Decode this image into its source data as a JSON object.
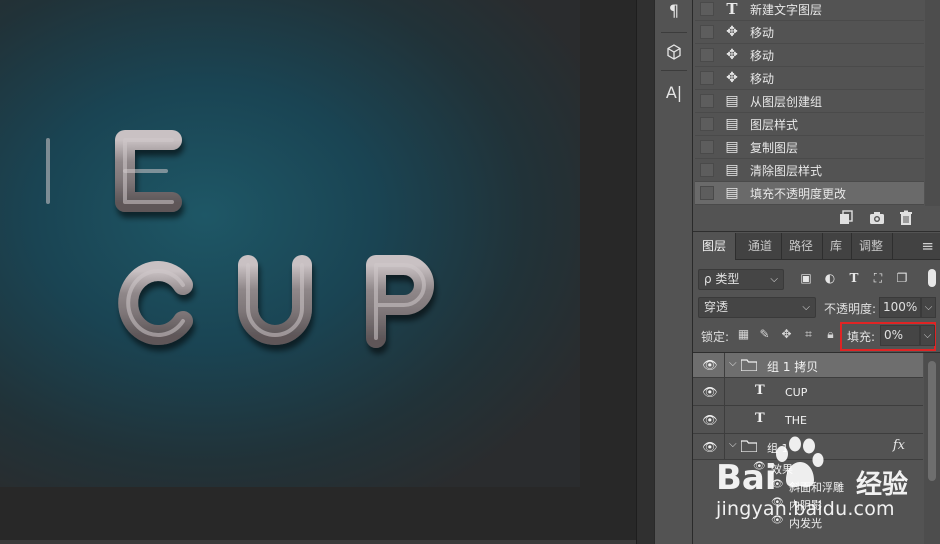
{
  "canvas": {
    "lines": [
      "HE",
      "CUP"
    ],
    "bg_color": "#1e5766",
    "text_color": "#9a9294"
  },
  "tool_strip": {
    "paragraph_icon": "pilcrow-icon",
    "cube_icon": "3d-cube-icon",
    "char_icon": "character-icon",
    "char_glyph": "A|"
  },
  "history": {
    "items": [
      {
        "icon": "T",
        "label": "新建文字图层"
      },
      {
        "icon": "✥",
        "label": "移动"
      },
      {
        "icon": "✥",
        "label": "移动"
      },
      {
        "icon": "✥",
        "label": "移动"
      },
      {
        "icon": "▤",
        "label": "从图层创建组"
      },
      {
        "icon": "▤",
        "label": "图层样式"
      },
      {
        "icon": "▤",
        "label": "复制图层"
      },
      {
        "icon": "▤",
        "label": "清除图层样式"
      },
      {
        "icon": "▤",
        "label": "填充不透明度更改"
      }
    ]
  },
  "layers_panel": {
    "tabs": [
      "图层",
      "通道",
      "路径",
      "库",
      "调整"
    ],
    "filter": {
      "label": "ρ 类型"
    },
    "blend_mode": "穿透",
    "opacity_label": "不透明度:",
    "opacity_value": "100%",
    "lock_label": "锁定:",
    "fill_label": "填充:",
    "fill_value": "0%",
    "highlight_color": "#e02424",
    "layers": [
      {
        "type": "group",
        "name": "组 1 拷贝",
        "expanded": true,
        "selected": true
      },
      {
        "type": "text",
        "name": "CUP"
      },
      {
        "type": "text",
        "name": "THE"
      },
      {
        "type": "group",
        "name": "组 1",
        "expanded": true,
        "fx": "fx"
      }
    ],
    "effects_label": "效果",
    "effects": [
      "斜面和浮雕",
      "内阴影",
      "内发光"
    ]
  },
  "watermark": {
    "brand": "Bai",
    "cn": "经验",
    "url": "jingyan.baidu.com"
  }
}
